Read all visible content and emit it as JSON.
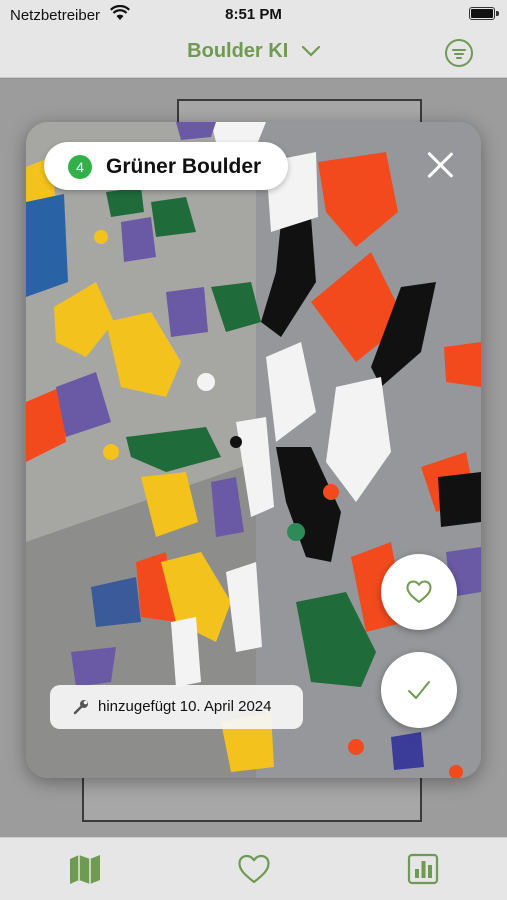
{
  "status_bar": {
    "carrier": "Netzbetreiber",
    "time": "8:51 PM"
  },
  "nav": {
    "title": "Boulder KI"
  },
  "route": {
    "grade": "4",
    "name": "Grüner Boulder",
    "grade_color": "#33b04a"
  },
  "added": {
    "text": "hinzugefügt 10. April 2024"
  },
  "accent_color": "#6f9a52",
  "icons": {
    "close": "close-icon",
    "like": "heart-icon",
    "done": "checkmark-icon",
    "wrench": "wrench-icon",
    "filter": "filter-icon",
    "tab_map": "map-icon",
    "tab_fav": "heart-icon",
    "tab_stats": "stats-icon"
  }
}
